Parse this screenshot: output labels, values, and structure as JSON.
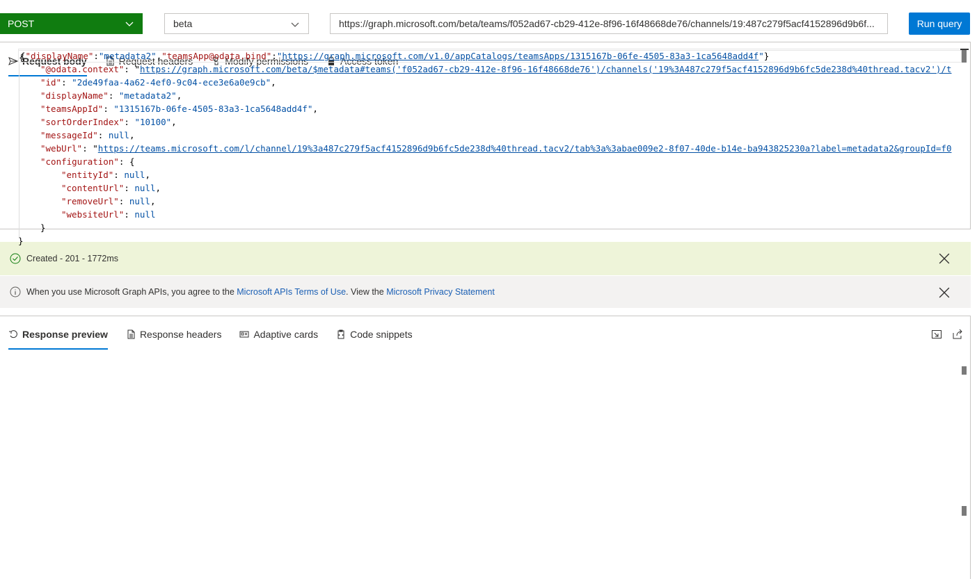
{
  "query": {
    "method": "POST",
    "version": "beta",
    "url": "https://graph.microsoft.com/beta/teams/f052ad67-cb29-412e-8f96-16f48668de76/channels/19:487c279f5acf4152896d9b6f...",
    "run_label": "Run query"
  },
  "request_tabs": [
    {
      "label": "Request body",
      "icon": "send-icon"
    },
    {
      "label": "Request headers",
      "icon": "document-icon"
    },
    {
      "label": "Modify permissions",
      "icon": "touch-icon"
    },
    {
      "label": "Access token",
      "icon": "lock-icon"
    }
  ],
  "request_body": {
    "open": "{",
    "key1": "\"displayName\"",
    "colon1": ":",
    "val1": "\"metadata2\"",
    "comma1": ",",
    "key2": "\"teamsApp@odata.bind\"",
    "colon2": ":",
    "q_open": "\"",
    "val2": "https://graph.microsoft.com/v1.0/appCatalogs/teamsApps/1315167b-06fe-4505-83a3-1ca5648add4f",
    "q_close": "\"",
    "close": "}"
  },
  "status": {
    "text": "Created - 201 - 1772ms",
    "color": "#eef4d9"
  },
  "info": {
    "prefix": "When you use Microsoft Graph APIs, you agree to the ",
    "terms_link": "Microsoft APIs Terms of Use",
    "middle": ". View the ",
    "privacy_link": "Microsoft Privacy Statement"
  },
  "response_tabs": [
    {
      "label": "Response preview",
      "icon": "undo-icon"
    },
    {
      "label": "Response headers",
      "icon": "document-icon"
    },
    {
      "label": "Adaptive cards",
      "icon": "card-icon"
    },
    {
      "label": "Code snippets",
      "icon": "clipboard-icon"
    }
  ],
  "response": {
    "open": "{",
    "odata_key": "\"@odata.context\"",
    "odata_val": "https://graph.microsoft.com/beta/$metadata#teams('f052ad67-cb29-412e-8f96-16f48668de76')/channels('19%3A487c279f5acf4152896d9b6fc5de238d%40thread.tacv2')/t",
    "id_key": "\"id\"",
    "id_val": "\"2de49faa-4a62-4ef0-9c04-ece3e6a0e9cb\"",
    "dn_key": "\"displayName\"",
    "dn_val": "\"metadata2\"",
    "tai_key": "\"teamsAppId\"",
    "tai_val": "\"1315167b-06fe-4505-83a3-1ca5648add4f\"",
    "soi_key": "\"sortOrderIndex\"",
    "soi_val": "\"10100\"",
    "mid_key": "\"messageId\"",
    "mid_val": "null",
    "web_key": "\"webUrl\"",
    "web_val": "https://teams.microsoft.com/l/channel/19%3a487c279f5acf4152896d9b6fc5de238d%40thread.tacv2/tab%3a%3abae009e2-8f07-40de-b14e-ba943825230a?label=metadata2&groupId=f0",
    "cfg_key": "\"configuration\"",
    "cfg_open": "{",
    "ent_key": "\"entityId\"",
    "cu_key": "\"contentUrl\"",
    "ru_key": "\"removeUrl\"",
    "wu_key": "\"websiteUrl\"",
    "null_val": "null",
    "cfg_close": "}",
    "close": "}"
  }
}
